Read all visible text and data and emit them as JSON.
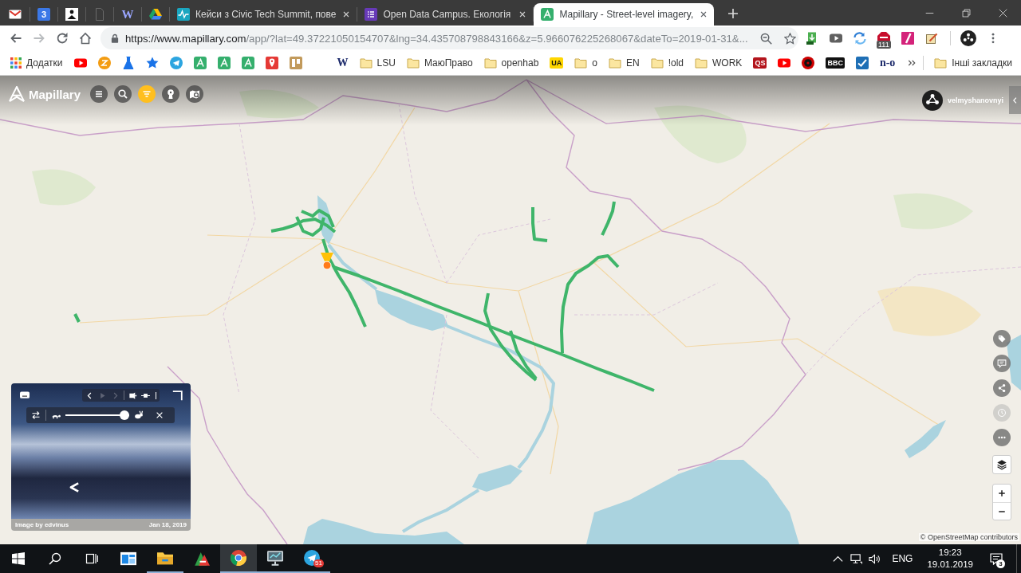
{
  "browser": {
    "pinned_tabs": [
      {
        "kind": "icon"
      },
      {
        "kind": "tile",
        "text": "3",
        "color": "#3b78e7"
      },
      {
        "kind": "icon"
      },
      {
        "kind": "icon"
      },
      {
        "kind": "letter",
        "text": "W"
      },
      {
        "kind": "icon"
      }
    ],
    "tabs": [
      {
        "title": "Кейси з Civic Tech Summit, пове",
        "selected": false
      },
      {
        "title": "Open Data Campus. Екологія",
        "selected": false
      },
      {
        "title": "Mapillary - Street-level imagery,",
        "selected": true
      }
    ],
    "nav_buttons": [
      {
        "disabled": false
      },
      {
        "disabled": true
      },
      {
        "disabled": false
      },
      {
        "disabled": false
      }
    ],
    "address_bar": {
      "host": "https://www.mapillary.com",
      "path": "/app/?lat=49.37221050154707&lng=34.435708798843166&z=5.966076225268067&dateTo=2019-01-31&..."
    },
    "extensions": [
      {
        "kind": "icon"
      },
      {
        "kind": "icon"
      },
      {
        "kind": "icon"
      },
      {
        "kind": "badged",
        "badge": "111"
      },
      {
        "kind": "icon"
      },
      {
        "kind": "icon"
      }
    ],
    "bookmarks": [
      {
        "kind": "apps",
        "label": "Додатки"
      },
      {
        "kind": "icon"
      },
      {
        "kind": "icon"
      },
      {
        "kind": "icon"
      },
      {
        "kind": "icon"
      },
      {
        "kind": "icon"
      },
      {
        "kind": "icon"
      },
      {
        "kind": "icon"
      },
      {
        "kind": "icon"
      },
      {
        "kind": "icon"
      },
      {
        "kind": "icon"
      },
      {
        "kind": "letter",
        "text": "W"
      },
      {
        "kind": "folder",
        "label": "LSU"
      },
      {
        "kind": "folder",
        "label": "МаюПраво"
      },
      {
        "kind": "folder",
        "label": "openhab"
      },
      {
        "kind": "tile",
        "text": "UA",
        "color": "#ffd600"
      },
      {
        "kind": "folder",
        "label": "o"
      },
      {
        "kind": "folder",
        "label": "EN"
      },
      {
        "kind": "folder",
        "label": "!old"
      },
      {
        "kind": "folder",
        "label": "WORK"
      },
      {
        "kind": "tile",
        "text": "QS",
        "color": "#b3141c"
      },
      {
        "kind": "icon"
      },
      {
        "kind": "icon"
      },
      {
        "kind": "tile",
        "text": "BBC",
        "color": "#111111"
      },
      {
        "kind": "icon"
      },
      {
        "kind": "letter",
        "text": "n-o"
      }
    ],
    "other_bookmarks": "Інші закладки"
  },
  "app": {
    "logo": "Mapillary",
    "toolbar": [
      {
        "selected": false
      },
      {
        "selected": false
      },
      {
        "selected": true
      },
      {
        "selected": false
      },
      {
        "selected": false
      }
    ],
    "user": "velmyshanovnyi",
    "side_controls": [
      {
        "disabled": false
      },
      {
        "disabled": false
      },
      {
        "disabled": false
      },
      {
        "disabled": true
      },
      {
        "disabled": false
      }
    ],
    "viewer": {
      "nav": [
        {
          "disabled": false
        },
        {
          "disabled": true
        },
        {
          "disabled": true
        }
      ],
      "speed": {
        "level": 1
      },
      "credit": "Image by edvinus",
      "date": "Jan 18, 2019"
    },
    "attribution": "© OpenStreetMap contributors"
  },
  "taskbar": {
    "apps": [
      {
        "running": false,
        "selected": false
      },
      {
        "running": true,
        "selected": false
      },
      {
        "running": false,
        "selected": false
      },
      {
        "running": true,
        "selected": true
      },
      {
        "running": true,
        "selected": false
      },
      {
        "running": true,
        "selected": false,
        "badge": "51"
      }
    ],
    "language": "ENG",
    "time": "19:23",
    "date": "19.01.2019",
    "notifications": "3"
  }
}
